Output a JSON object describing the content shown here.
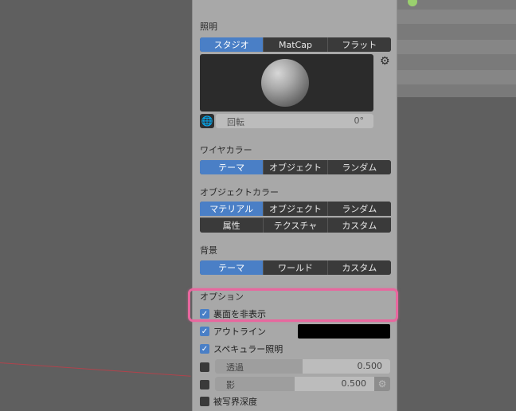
{
  "lighting": {
    "label": "照明",
    "tabs": [
      "スタジオ",
      "MatCap",
      "フラット"
    ],
    "active": 0,
    "rotation_label": "回転",
    "rotation_value": "0°",
    "icons": {
      "settings": "gear-icon",
      "world": "globe-icon"
    }
  },
  "wire_color": {
    "label": "ワイヤカラー",
    "tabs": [
      "テーマ",
      "オブジェクト",
      "ランダム"
    ],
    "active": 0
  },
  "object_color": {
    "label": "オブジェクトカラー",
    "row1": [
      "マテリアル",
      "オブジェクト",
      "ランダム"
    ],
    "row2": [
      "属性",
      "テクスチャ",
      "カスタム"
    ],
    "active": "マテリアル"
  },
  "background": {
    "label": "背景",
    "tabs": [
      "テーマ",
      "ワールド",
      "カスタム"
    ],
    "active": 0
  },
  "options": {
    "label": "オプション",
    "backface_culling": {
      "label": "裏面を非表示",
      "checked": true
    },
    "outline": {
      "label": "アウトライン",
      "checked": true,
      "color": "#000000"
    },
    "specular": {
      "label": "スペキュラー照明",
      "checked": true
    },
    "xray": {
      "label": "透過",
      "value": "0.500",
      "fill_fraction": 0.5,
      "checked": false
    },
    "shadow": {
      "label": "影",
      "value": "0.500",
      "fill_fraction": 0.5,
      "checked": false
    },
    "dof": {
      "label": "被写界深度",
      "checked": false
    }
  },
  "colors": {
    "accent": "#4a7fc6",
    "highlight": "#e8679e"
  }
}
